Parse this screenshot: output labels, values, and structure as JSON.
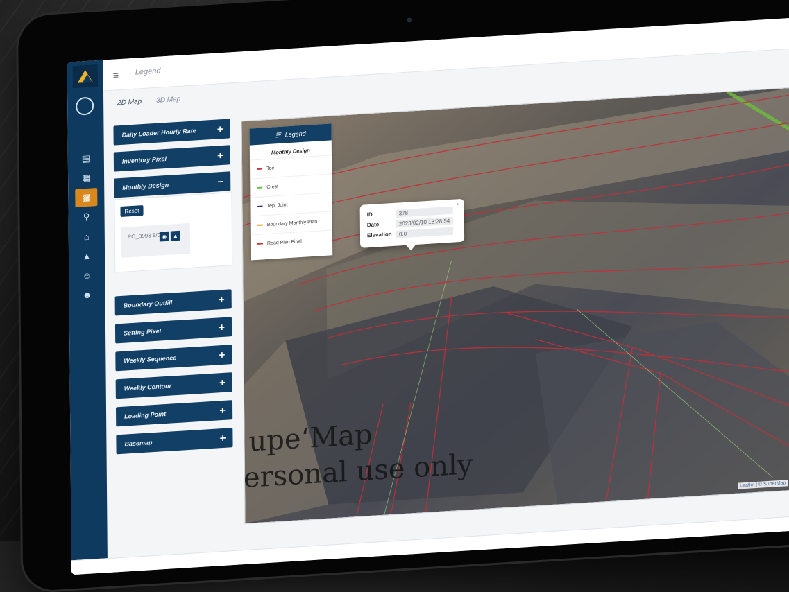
{
  "app": {
    "top_title": "Legend",
    "tabs": [
      {
        "label": "2D Map"
      },
      {
        "label": "3D Map"
      }
    ],
    "sidebar_icons": [
      "user-icon",
      "document-icon",
      "calendar-icon",
      "map-icon",
      "search-icon",
      "building-icon",
      "chart-icon",
      "user-add-icon",
      "group-icon"
    ]
  },
  "left_panel": {
    "sections": [
      {
        "label": "Daily Loader Hourly Rate"
      },
      {
        "label": "Inventory Pixel"
      },
      {
        "label": "Monthly Design"
      },
      {
        "label": "Boundary Outfill"
      },
      {
        "label": "Setting Pixel"
      },
      {
        "label": "Weekly Sequence"
      },
      {
        "label": "Weekly Contour"
      },
      {
        "label": "Loading Point"
      },
      {
        "label": "Basemap"
      }
    ],
    "monthly_design": {
      "reset_label": "Reset",
      "item_text": "PO_3993 8/00"
    }
  },
  "legend": {
    "title": "Legend",
    "subtitle": "Monthly Design",
    "items": [
      {
        "label": "Toe",
        "color": "#d1303a"
      },
      {
        "label": "Crest",
        "color": "#6cbf4b"
      },
      {
        "label": "Tept Joint",
        "color": "#2b3a8f"
      },
      {
        "label": "Boundary Monthly Plan",
        "color": "#e0a020"
      },
      {
        "label": "Road Plan Final",
        "color": "#c0392b"
      }
    ]
  },
  "popup": {
    "rows": [
      {
        "key": "ID",
        "value": "378"
      },
      {
        "key": "Date",
        "value": "2023/02/10 18:28:54"
      },
      {
        "key": "Elevation",
        "value": "0.0"
      }
    ]
  },
  "map": {
    "watermark_line1": "upe‘Map",
    "watermark_line2": "ersonal use only",
    "attribution": "Leaflet | © SuperMap"
  }
}
